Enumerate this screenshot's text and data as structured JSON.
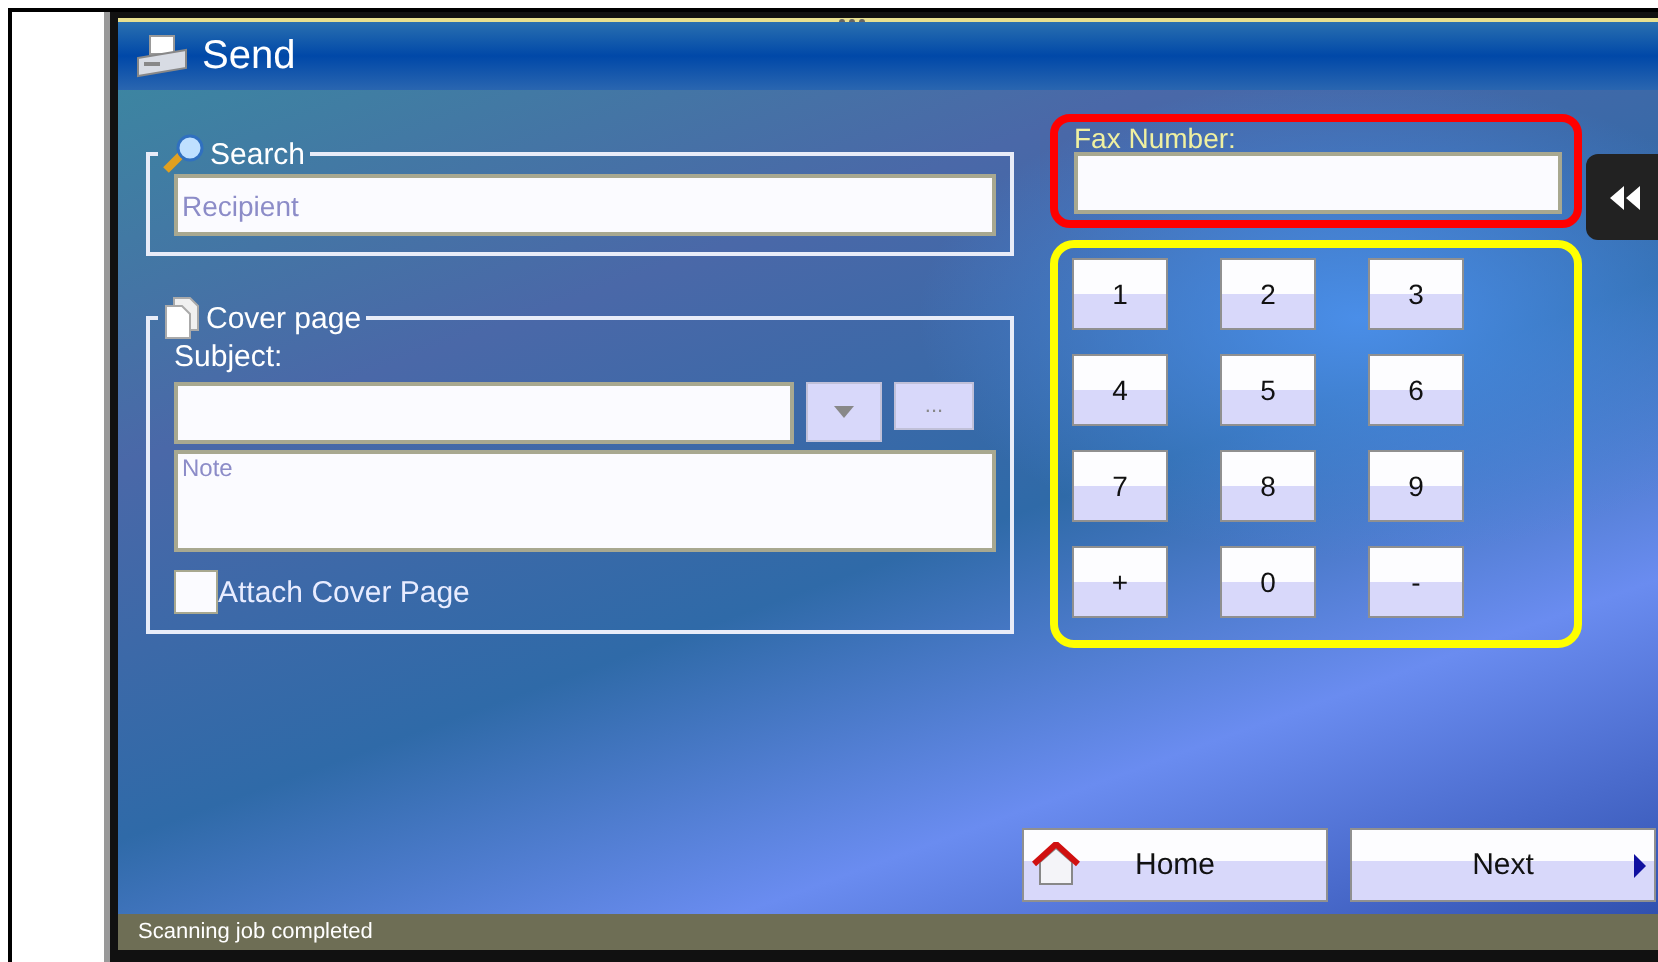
{
  "window": {
    "title": "Send"
  },
  "search": {
    "title": "Search",
    "placeholder": "Recipient"
  },
  "cover_page": {
    "title": "Cover page",
    "subject_label": "Subject:",
    "more_button": "...",
    "note_placeholder": "Note",
    "attach": {
      "label": "Attach Cover Page",
      "checked": false
    }
  },
  "fax_number": {
    "label": "Fax Number:"
  },
  "keypad": [
    "1",
    "2",
    "3",
    "4",
    "5",
    "6",
    "7",
    "8",
    "9",
    "+",
    "0",
    "-"
  ],
  "footer_buttons": [
    {
      "label": "Home",
      "kind": "home"
    },
    {
      "label": "Next",
      "kind": "next"
    }
  ],
  "status_bar": "Scanning job completed"
}
